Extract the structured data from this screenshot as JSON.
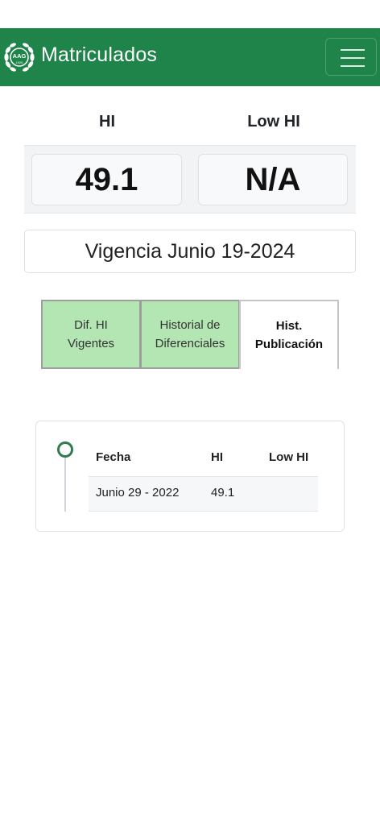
{
  "header": {
    "title": "Matriculados",
    "logo_text": "AAG",
    "logo_year": "1926"
  },
  "handicap": {
    "hi_label": "HI",
    "low_hi_label": "Low HI",
    "hi_value": "49.1",
    "low_hi_value": "N/A"
  },
  "vigencia": "Vigencia Junio 19-2024",
  "tabs": [
    {
      "label": "Dif. HI\nVigentes",
      "active": false
    },
    {
      "label": "Historial de\nDiferenciales",
      "active": false
    },
    {
      "label": "Hist.\nPublicación",
      "active": true
    }
  ],
  "history": {
    "columns": [
      "Fecha",
      "HI",
      "Low HI"
    ],
    "rows": [
      {
        "fecha": "Junio 29 - 2022",
        "hi": "49.1",
        "low_hi": ""
      }
    ]
  },
  "colors": {
    "navbar": "#1e8449",
    "tab_inactive": "#b4e6b4",
    "timeline": "#2e7d4f"
  }
}
